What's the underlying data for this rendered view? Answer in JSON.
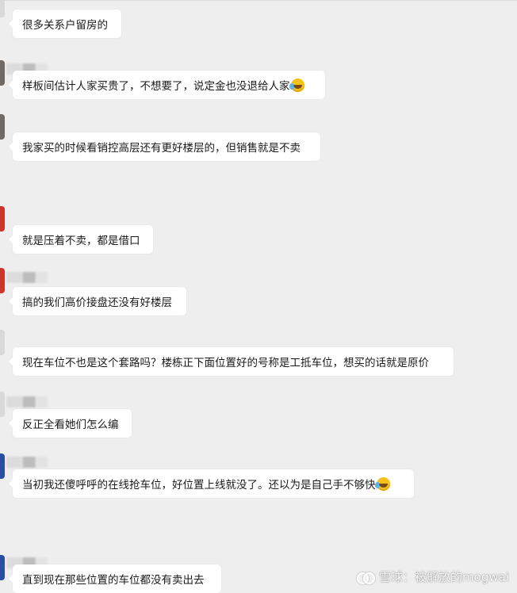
{
  "messages": [
    {
      "text": "很多关系户留房的",
      "emoji": false
    },
    {
      "text": "样板间估计人家买贵了，不想要了，说定金也没退给人家",
      "emoji": true
    },
    {
      "text": "我家买的时候看销控高层还有更好楼层的，但销售就是不卖",
      "emoji": false
    },
    {
      "text": "就是压着不卖，都是借口",
      "emoji": false
    },
    {
      "text": "搞的我们高价接盘还没有好楼层",
      "emoji": false
    },
    {
      "text": "现在车位不也是这个套路吗？楼栋正下面位置好的号称是工抵车位，想买的话就是原价",
      "emoji": false
    },
    {
      "text": "反正全看她们怎么编",
      "emoji": false
    },
    {
      "text": "当初我还傻呼呼的在线抢车位，好位置上线就没了。还以为是自己手不够快",
      "emoji": true
    },
    {
      "text": "直到现在那些位置的车位都没有卖出去",
      "emoji": false
    }
  ],
  "emoji_icon": "face-with-tears-of-joy-icon",
  "watermark": {
    "text": "雪球：被解放的mogwai",
    "icon": "xueqiu-logo-icon"
  }
}
